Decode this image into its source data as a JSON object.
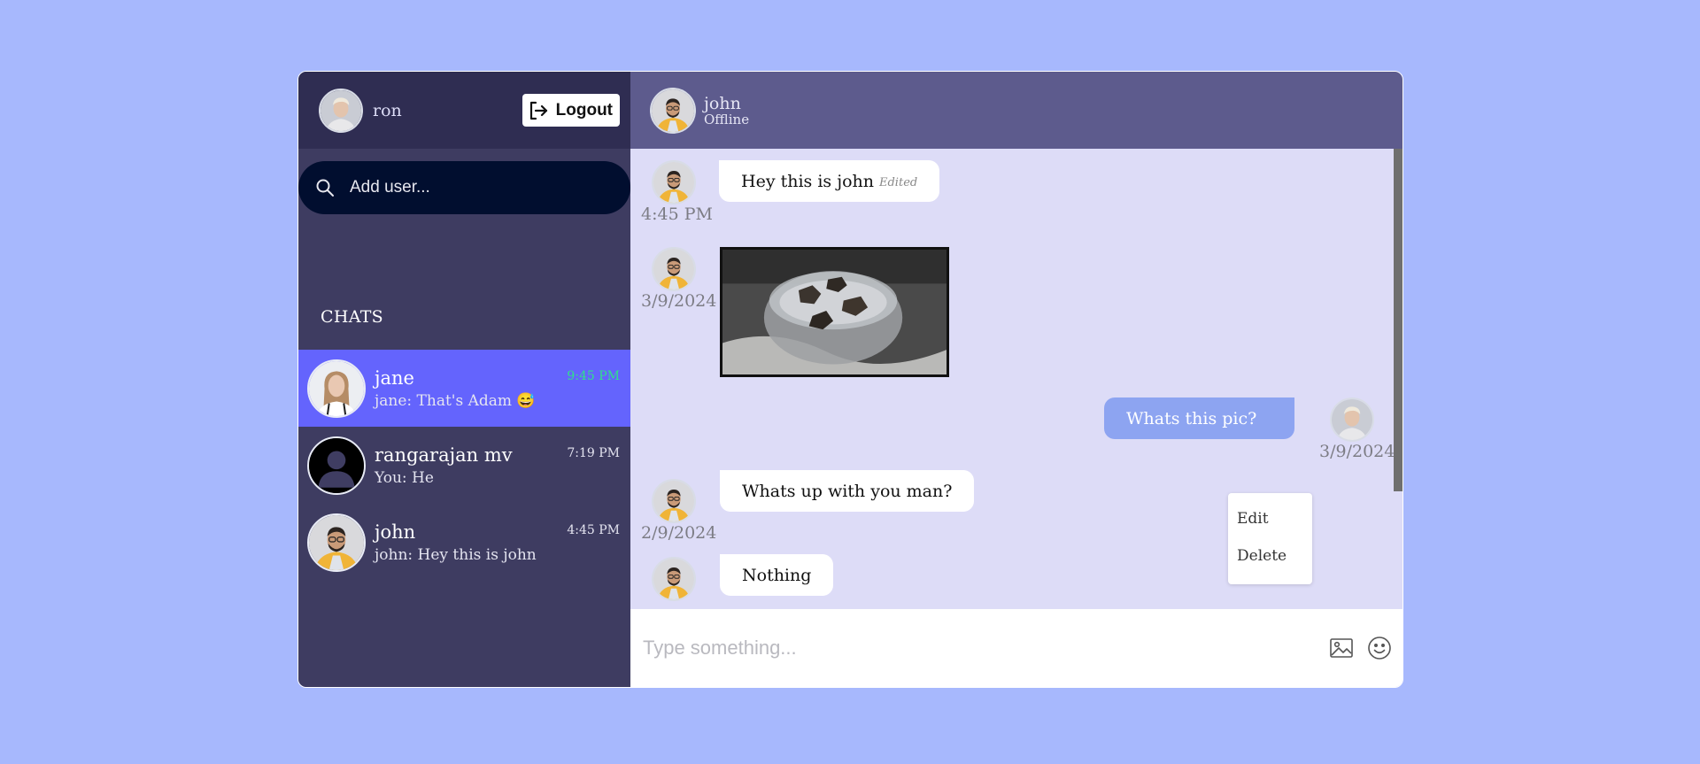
{
  "current_user": {
    "name": "ron"
  },
  "logout": {
    "label": "Logout"
  },
  "search": {
    "placeholder": "Add user..."
  },
  "chats_heading": "CHATS",
  "chats": [
    {
      "name": "jane",
      "preview": "jane: That's Adam 😅",
      "time": "9:45 PM",
      "active": true
    },
    {
      "name": "rangarajan mv",
      "preview": "You: He",
      "time": "7:19 PM",
      "active": false
    },
    {
      "name": "john",
      "preview": "john: Hey this is john",
      "time": "4:45 PM",
      "active": false
    }
  ],
  "conversation": {
    "peer_name": "john",
    "peer_status": "Offline",
    "messages": [
      {
        "from": "john",
        "text": "Hey this is john",
        "edited_label": "Edited",
        "time": "4:45 PM"
      },
      {
        "from": "john",
        "type": "image",
        "time": "3/9/2024"
      },
      {
        "from": "ron",
        "text": "Whats this pic?",
        "time": "3/9/2024"
      },
      {
        "from": "john",
        "text": "Whats up with you man?",
        "time": "2/9/2024"
      },
      {
        "from": "john",
        "text": "Nothing",
        "time": ""
      }
    ]
  },
  "context_menu": {
    "edit": "Edit",
    "delete": "Delete"
  },
  "composer": {
    "placeholder": "Type something...",
    "image_icon": "image-icon",
    "emoji_icon": "smiley-icon"
  },
  "colors": {
    "page_bg": "#a7b8fd",
    "sidebar_bg": "#3e3c61",
    "sidebar_header_bg": "#2f2d52",
    "active_chat": "#6464fd",
    "chat_header_bg": "#5d5b8d",
    "messages_bg": "#dddcf7",
    "own_bubble": "#8da4f1",
    "search_bg": "#010e2f",
    "active_time": "#30e08a"
  }
}
